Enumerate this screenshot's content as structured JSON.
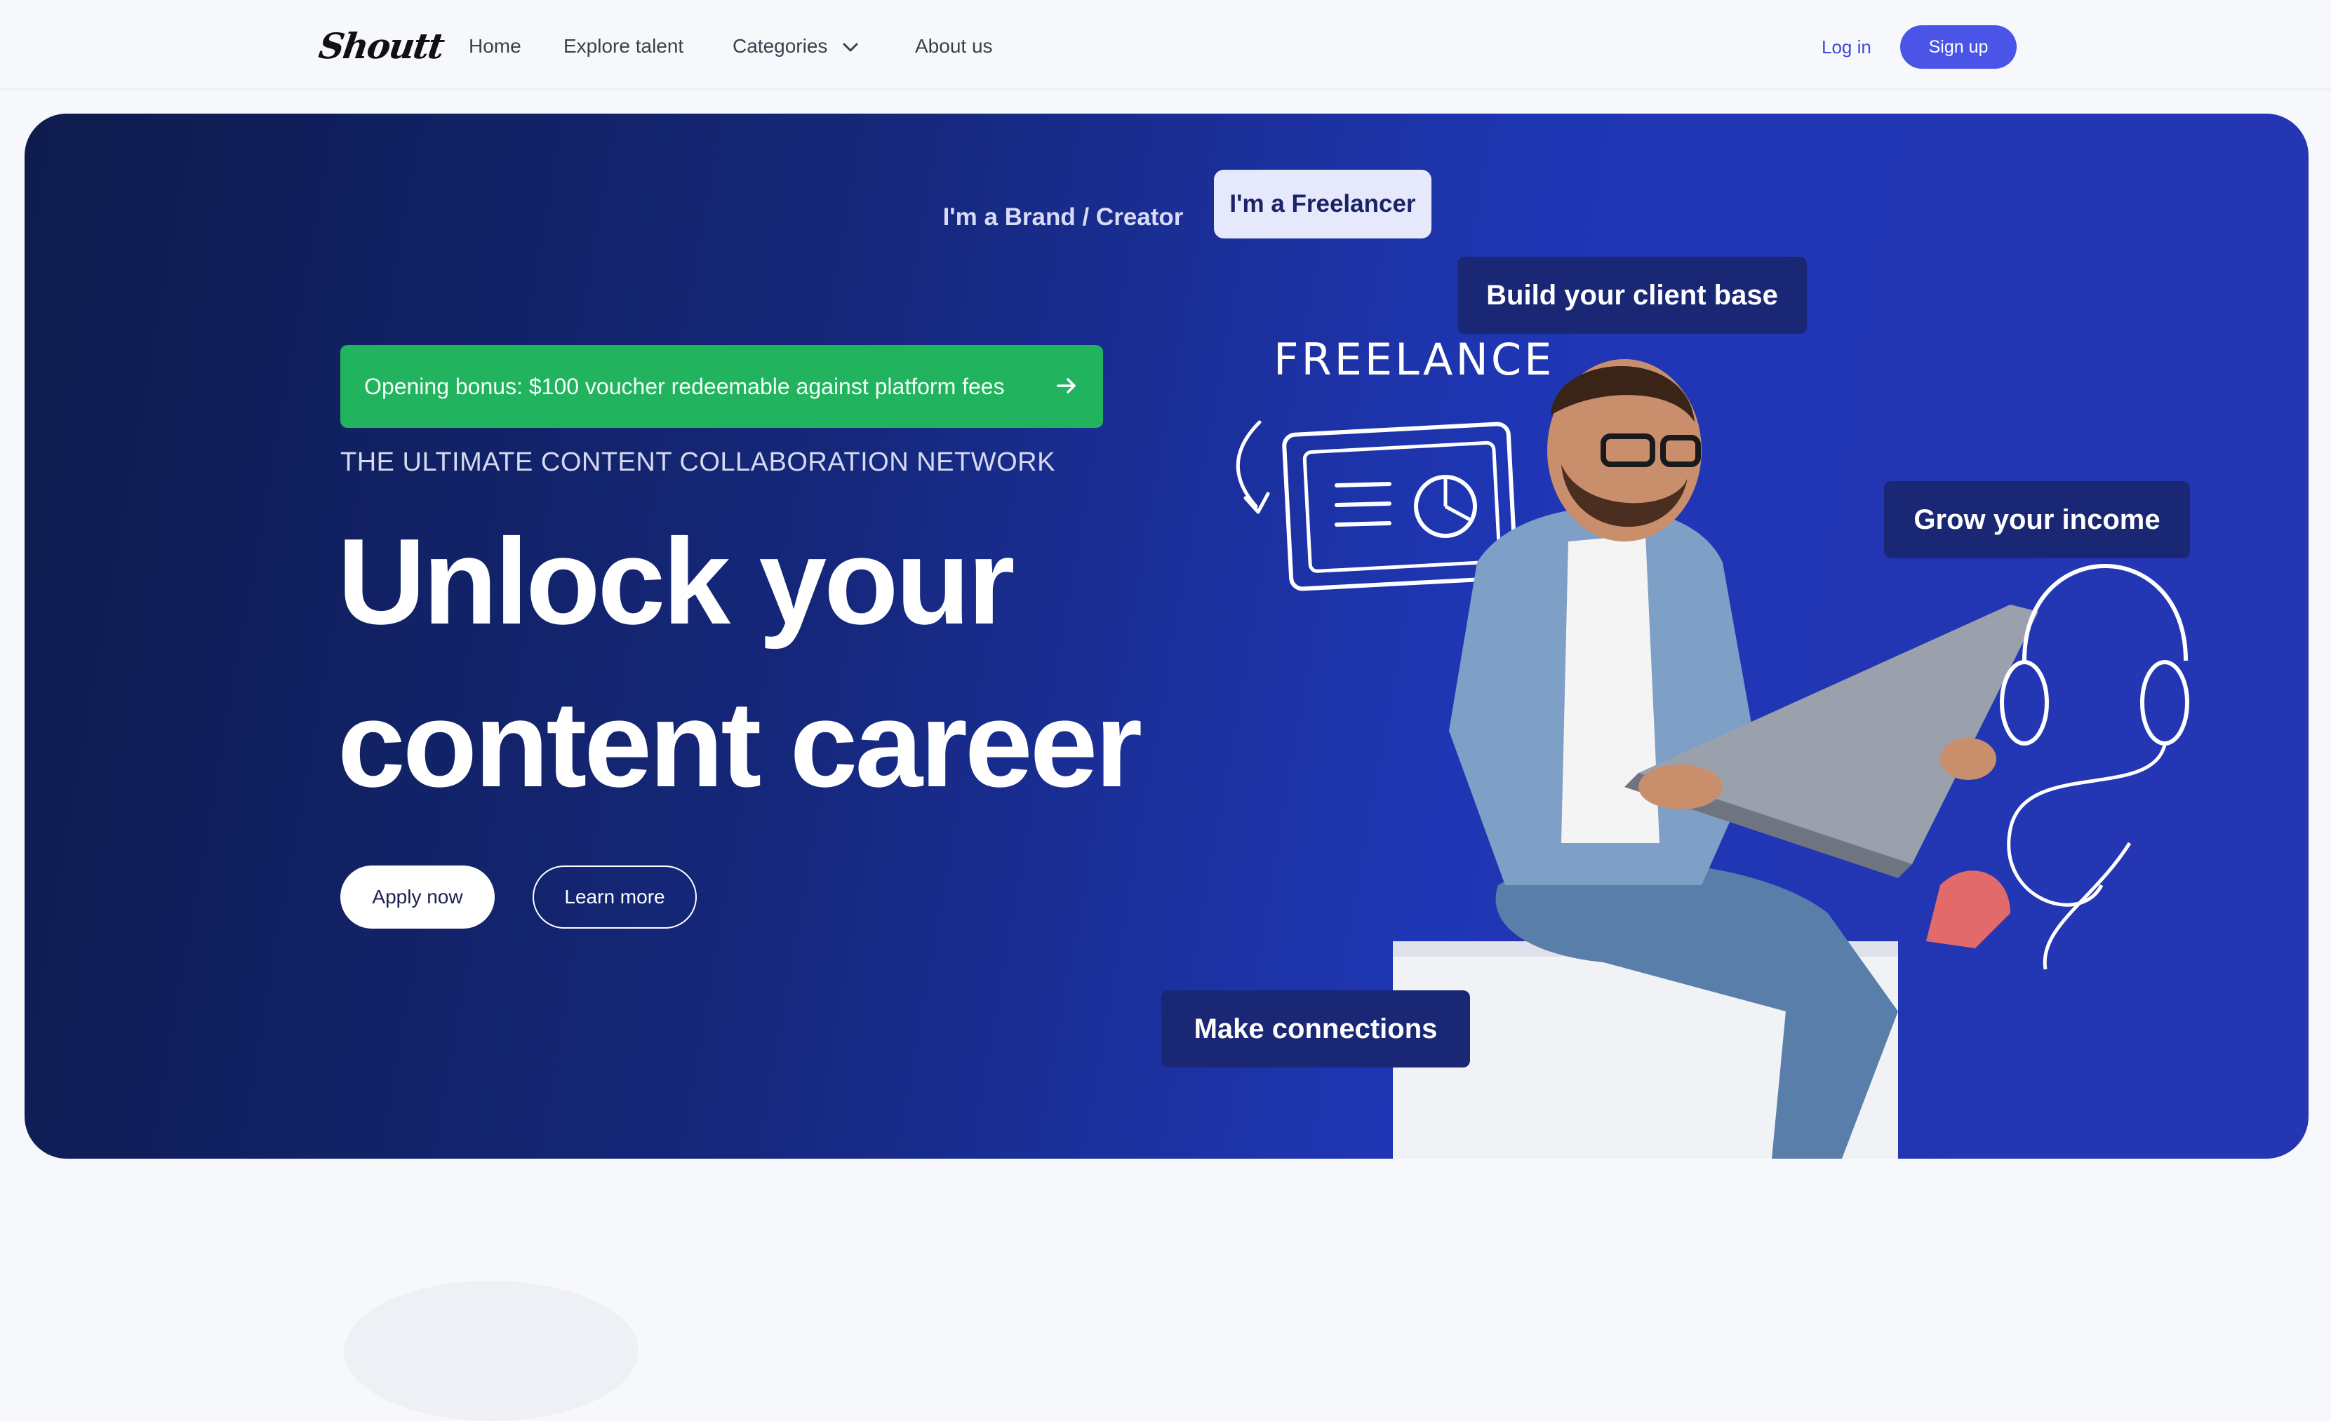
{
  "nav": {
    "logo": "Shoutt",
    "links": [
      "Home",
      "Explore talent",
      "Categories",
      "About us"
    ],
    "login": "Log in",
    "signup": "Sign up"
  },
  "hero": {
    "toggle": {
      "brand": "I'm a Brand / Creator",
      "freelancer": "I'm a Freelancer",
      "selected": "I'm a Freelancer"
    },
    "bonus": "Opening bonus: $100 voucher redeemable against platform fees",
    "eyebrow": "THE ULTIMATE CONTENT COLLABORATION NETWORK",
    "headline_line1": "Unlock your",
    "headline_line2": "content career",
    "apply": "Apply now",
    "learn": "Learn more",
    "chips": {
      "client_base": "Build your client base",
      "income": "Grow your income",
      "connections": "Make connections"
    },
    "doodle_label": "FREELANCE"
  },
  "colors": {
    "brand_blue": "#4a55e8",
    "hero_dark": "#0e1b4c",
    "hero_light": "#2536b4",
    "bonus_green": "#22b35f",
    "chip_bg": "#1a2775"
  }
}
